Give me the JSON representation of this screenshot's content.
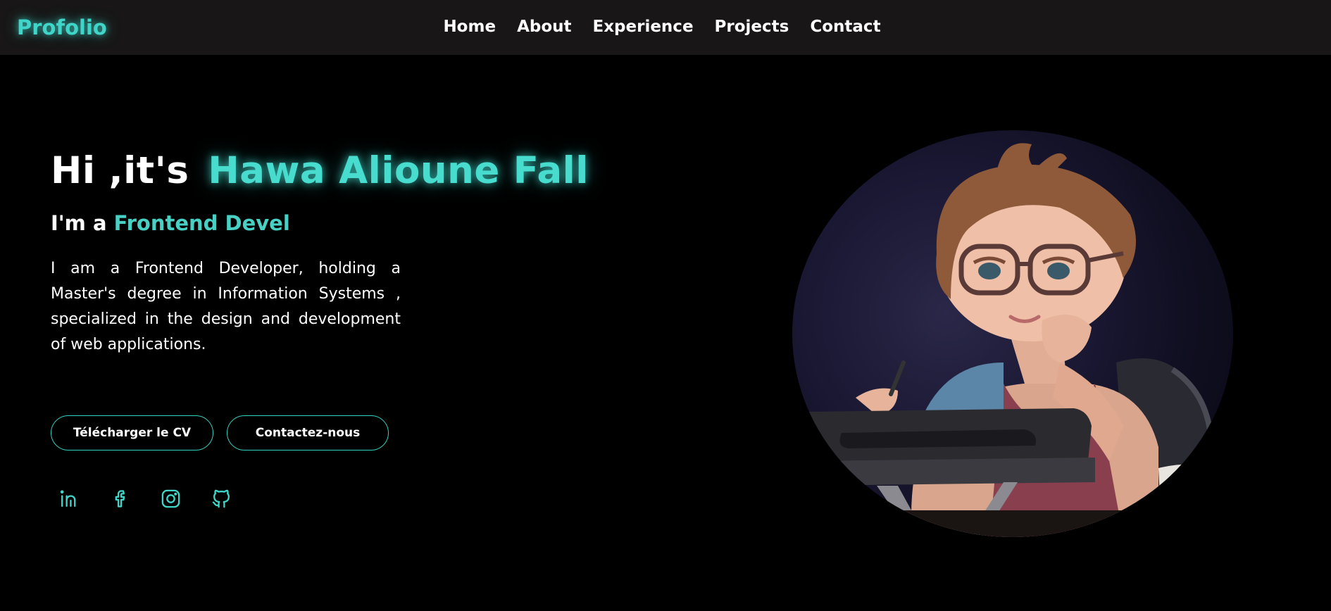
{
  "brand": {
    "logo": "Profolio",
    "accent_color": "#3fd6c9"
  },
  "nav": {
    "items": [
      {
        "label": "Home"
      },
      {
        "label": "About"
      },
      {
        "label": "Experience"
      },
      {
        "label": "Projects"
      },
      {
        "label": "Contact"
      }
    ]
  },
  "hero": {
    "greeting": "Hi ,it's",
    "name": "Hawa Alioune Fall",
    "subtitle_prefix": "I'm a",
    "subtitle_role": "Frontend Devel",
    "bio": "I am a Frontend Developer, holding a Master's degree in Information Systems , specialized in the design and development of web applications.",
    "buttons": {
      "download_cv": "Télécharger le CV",
      "contact": "Contactez-nous"
    },
    "socials": [
      {
        "icon": "linkedin-icon"
      },
      {
        "icon": "facebook-icon"
      },
      {
        "icon": "instagram-icon"
      },
      {
        "icon": "github-icon"
      }
    ],
    "portrait": {
      "icon": "avatar-illustration"
    }
  }
}
